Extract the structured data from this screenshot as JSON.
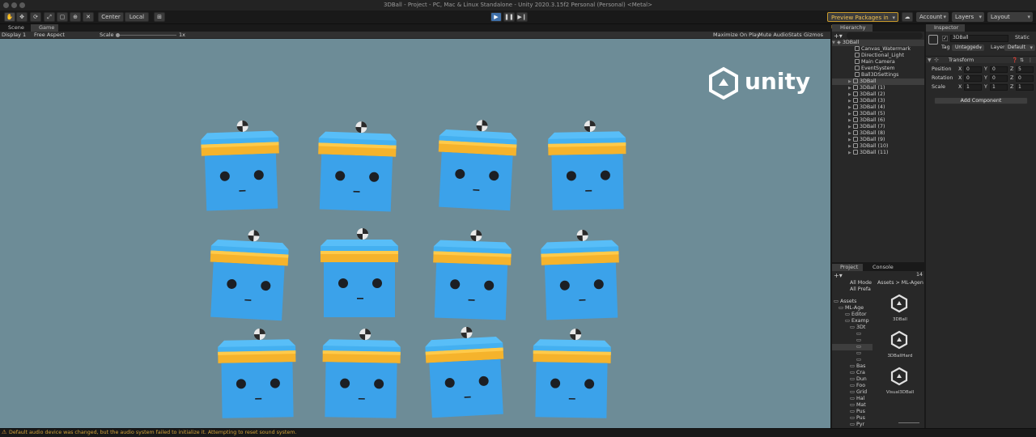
{
  "window": {
    "title": "3DBall - Project - PC, Mac & Linux Standalone - Unity 2020.3.15f2 Personal (Personal) <Metal>"
  },
  "toolbar": {
    "pivot_label": "Center",
    "space_label": "Local",
    "preview_packages": "Preview Packages in Use",
    "account": "Account",
    "layers": "Layers",
    "layout": "Layout"
  },
  "scene_panel": {
    "tabs": [
      "Scene",
      "Game"
    ],
    "display": "Display 1",
    "aspect": "Free Aspect",
    "scale_label": "Scale",
    "scale_value": "1x",
    "maximize": "Maximize On Play",
    "mute": "Mute Audio",
    "stats": "Stats",
    "gizmos": "Gizmos"
  },
  "game_view": {
    "logo_text": "unity",
    "box_color": "#3ba2ea",
    "band_color": "#f5b32c",
    "bg_color": "#6d8c97"
  },
  "hierarchy": {
    "tab": "Hierarchy",
    "scene": "3DBall",
    "items": [
      "Canvas_Watermark",
      "Directional_Light",
      "Main Camera",
      "EventSystem",
      "Ball3DSettings",
      "3DBall",
      "3DBall (1)",
      "3DBall (2)",
      "3DBall (3)",
      "3DBall (4)",
      "3DBall (5)",
      "3DBall (6)",
      "3DBall (7)",
      "3DBall (8)",
      "3DBall (9)",
      "3DBall (10)",
      "3DBall (11)"
    ]
  },
  "inspector": {
    "tab": "Inspector",
    "object_name": "3DBall",
    "static_label": "Static",
    "tag_label": "Tag",
    "tag_value": "Untagged",
    "layer_label": "Layer",
    "layer_value": "Default",
    "component": "Transform",
    "rows": [
      {
        "label": "Position",
        "x": "0",
        "y": "0",
        "z": "5"
      },
      {
        "label": "Rotation",
        "x": "0",
        "y": "0",
        "z": "0"
      },
      {
        "label": "Scale",
        "x": "1",
        "y": "1",
        "z": "1"
      }
    ],
    "axis": [
      "X",
      "Y",
      "Z"
    ],
    "add_component": "Add Component"
  },
  "project": {
    "tabs": [
      "Project",
      "Console"
    ],
    "count": "14",
    "filters": [
      "All Mode",
      "All Prefa"
    ],
    "breadcrumb": "Assets > ML-Agen",
    "tree": [
      "Assets",
      "ML-Age",
      "Editor",
      "Examp",
      "3Dt",
      "",
      "",
      "",
      "",
      "",
      "Bas",
      "Cra",
      "Dun",
      "Foo",
      "Grid",
      "Hal",
      "Mat",
      "Pus",
      "Pus",
      "Pyr"
    ],
    "assets": [
      "3DBall",
      "3DBallHard",
      "Visual3DBall"
    ]
  },
  "status": {
    "message": "Default audio device was changed, but the audio system failed to initialize it. Attempting to reset sound system."
  }
}
